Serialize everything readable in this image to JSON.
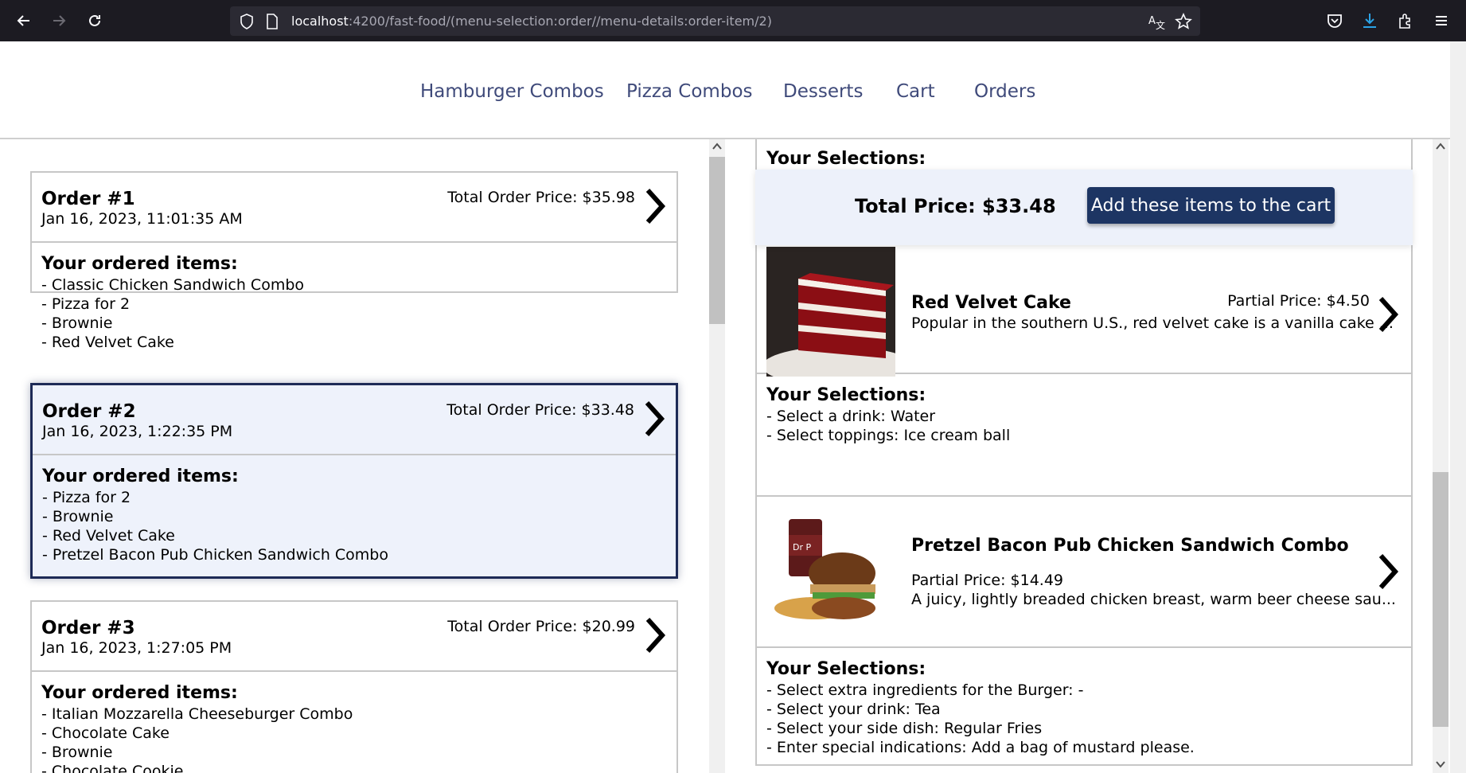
{
  "browser": {
    "url_host": "localhost",
    "url_path": ":4200/fast-food/(menu-selection:order//menu-details:order-item/2)"
  },
  "nav": {
    "links": [
      "Hamburger Combos",
      "Pizza Combos",
      "Desserts",
      "Cart",
      "Orders"
    ]
  },
  "orders": [
    {
      "title": "Order #1",
      "date": "Jan 16, 2023, 11:01:35 AM",
      "price": "Total Order Price: $35.98",
      "items_label": "Your ordered items:",
      "items": [
        "- Classic Chicken Sandwich Combo",
        "- Pizza for 2",
        "- Brownie",
        "- Red Velvet Cake"
      ]
    },
    {
      "title": "Order #2",
      "date": "Jan 16, 2023, 1:22:35 PM",
      "price": "Total Order Price: $33.48",
      "items_label": "Your ordered items:",
      "items": [
        "- Pizza for 2",
        "- Brownie",
        "- Red Velvet Cake",
        "- Pretzel Bacon Pub Chicken Sandwich Combo"
      ]
    },
    {
      "title": "Order #3",
      "date": "Jan 16, 2023, 1:27:05 PM",
      "price": "Total Order Price: $20.99",
      "items_label": "Your ordered items:",
      "items": [
        "- Italian Mozzarella Cheeseburger Combo",
        "- Chocolate Cake",
        "- Brownie",
        "- Chocolate Cookie"
      ]
    }
  ],
  "details": {
    "top_selections_label": "Your Selections:",
    "total_price": "Total Price: $33.48",
    "add_button": "Add these items to the cart",
    "items": [
      {
        "name": "Red Velvet Cake",
        "partial": "Partial Price: $4.50",
        "desc": "Popular in the southern U.S., red velvet cake is a vanilla cake ...",
        "selections_label": "Your Selections:",
        "selections": [
          "- Select a drink: Water",
          "- Select toppings: Ice cream ball"
        ]
      },
      {
        "name": "Pretzel Bacon Pub Chicken Sandwich Combo",
        "partial": "Partial Price: $14.49",
        "desc": "A juicy, lightly breaded chicken breast, warm beer cheese sau...",
        "selections_label": "Your Selections:",
        "selections": [
          "- Select extra ingredients for the Burger: -",
          "- Select your drink: Tea",
          "- Select your side dish: Regular Fries",
          "- Enter special indications: Add a bag of mustard please."
        ]
      }
    ]
  },
  "colors": {
    "nav_link": "#3f4a7a",
    "active_border": "#1d2a56",
    "active_bg": "#eef2fb",
    "button_bg": "#1d3563"
  }
}
